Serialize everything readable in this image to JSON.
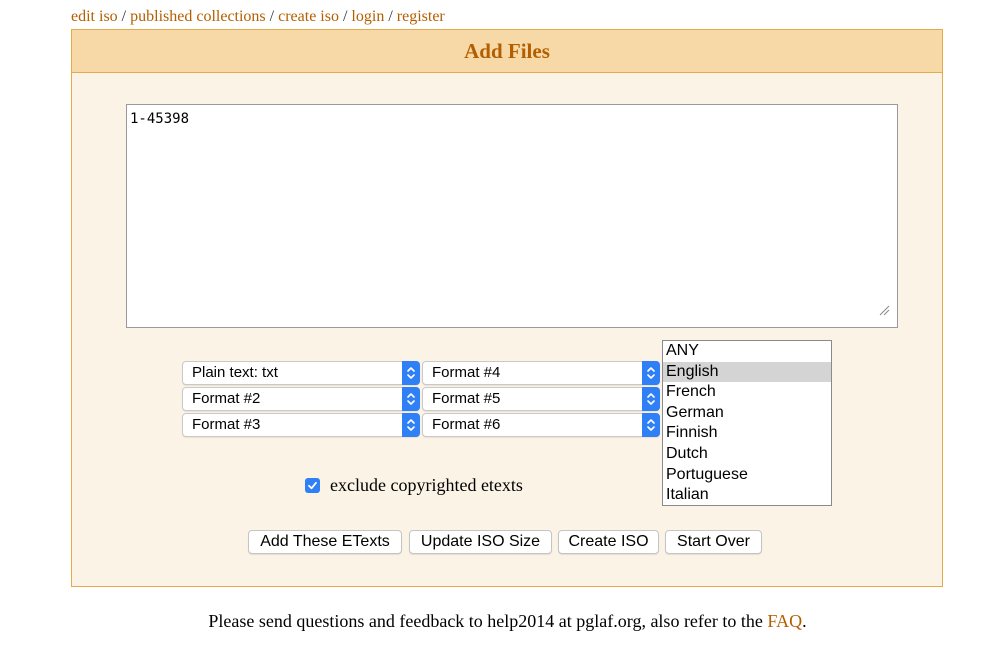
{
  "nav": {
    "links": [
      "edit iso",
      "published collections",
      "create iso",
      "login",
      "register"
    ],
    "separator": "/"
  },
  "panel": {
    "title": "Add Files",
    "etexts_value": "1-45398"
  },
  "formats": {
    "format1": "Plain text: txt",
    "format2": "Format #2",
    "format3": "Format #3",
    "format4": "Format #4",
    "format5": "Format #5",
    "format6": "Format #6"
  },
  "languages": {
    "options": [
      "ANY",
      "English",
      "French",
      "German",
      "Finnish",
      "Dutch",
      "Portuguese",
      "Italian"
    ],
    "selected": "English"
  },
  "exclude_copyrighted": {
    "label": "exclude copyrighted etexts",
    "checked": true
  },
  "buttons": {
    "add": "Add These ETexts",
    "update": "Update ISO Size",
    "create": "Create ISO",
    "start_over": "Start Over"
  },
  "footer": {
    "text": "Please send questions and feedback to help2014 at pglaf.org, also refer to the",
    "link": "FAQ",
    "end": "."
  },
  "colors": {
    "link": "#b35f00",
    "panel_border": "#e6a94c",
    "panel_header_bg": "#f7d9a8",
    "panel_bg": "#fbf4e6",
    "accent": "#2f7ff6"
  },
  "icons": {
    "select_arrow": "chevron-up-down-icon",
    "checkbox": "checkmark-icon",
    "resize": "resize-grip-icon"
  }
}
